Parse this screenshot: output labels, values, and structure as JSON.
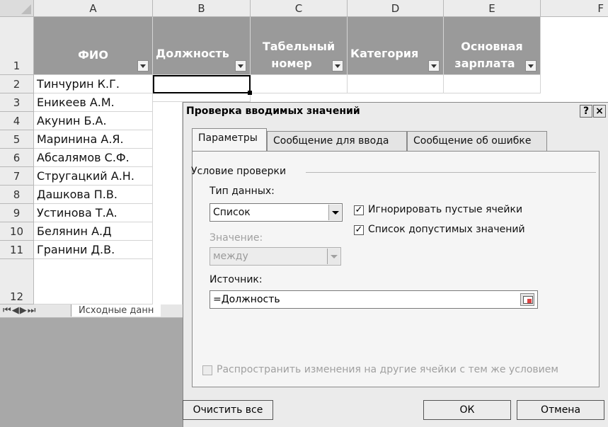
{
  "columns": [
    "A",
    "B",
    "C",
    "D",
    "E",
    "F"
  ],
  "rows": [
    "1",
    "2",
    "3",
    "4",
    "5",
    "6",
    "7",
    "8",
    "9",
    "10",
    "11",
    "12"
  ],
  "header_cells": {
    "a": "ФИО",
    "b": "Должность",
    "c_line1": "Табельный",
    "c_line2": "номер",
    "d": "Категория",
    "e_line1": "Основная",
    "e_line2": "зарплата"
  },
  "names": [
    "Тинчурин К.Г.",
    "Еникеев А.М.",
    "Акунин Б.А.",
    "Маринина А.Я.",
    "Абсалямов С.Ф.",
    "Стругацкий А.Н.",
    "Дашкова П.В.",
    "Устинова Т.А.",
    "Белянин А.Д",
    "Гранини Д.В."
  ],
  "sheet_tabs": {
    "nav": "⏮◀▶⏭",
    "active": "Исходные данн"
  },
  "dialog": {
    "title": "Проверка вводимых значений",
    "help_button": "?",
    "close_button": "×",
    "tabs": [
      "Параметры",
      "Сообщение для ввода",
      "Сообщение об ошибке"
    ],
    "group_label": "Условие проверки",
    "data_type_label": "Тип данных:",
    "data_type_value": "Список",
    "value_label": "Значение:",
    "value_value": "между",
    "ignore_blank_label": "Игнорировать пустые ячейки",
    "ignore_blank_checked": true,
    "in_cell_dropdown_label": "Список допустимых значений",
    "in_cell_dropdown_checked": true,
    "source_label": "Источник:",
    "source_value": "=Должность",
    "apply_to_all_label": "Распространить изменения на другие ячейки с тем же условием",
    "apply_to_all_checked": false,
    "clear_all_button": "Очистить все",
    "ok_button": "ОК",
    "cancel_button": "Отмена"
  },
  "colors": {
    "header_fill": "#9a9a9a",
    "header_text": "#ffffff",
    "dialog_bg": "#ebebeb",
    "disabled_text": "#a0a0a0"
  }
}
